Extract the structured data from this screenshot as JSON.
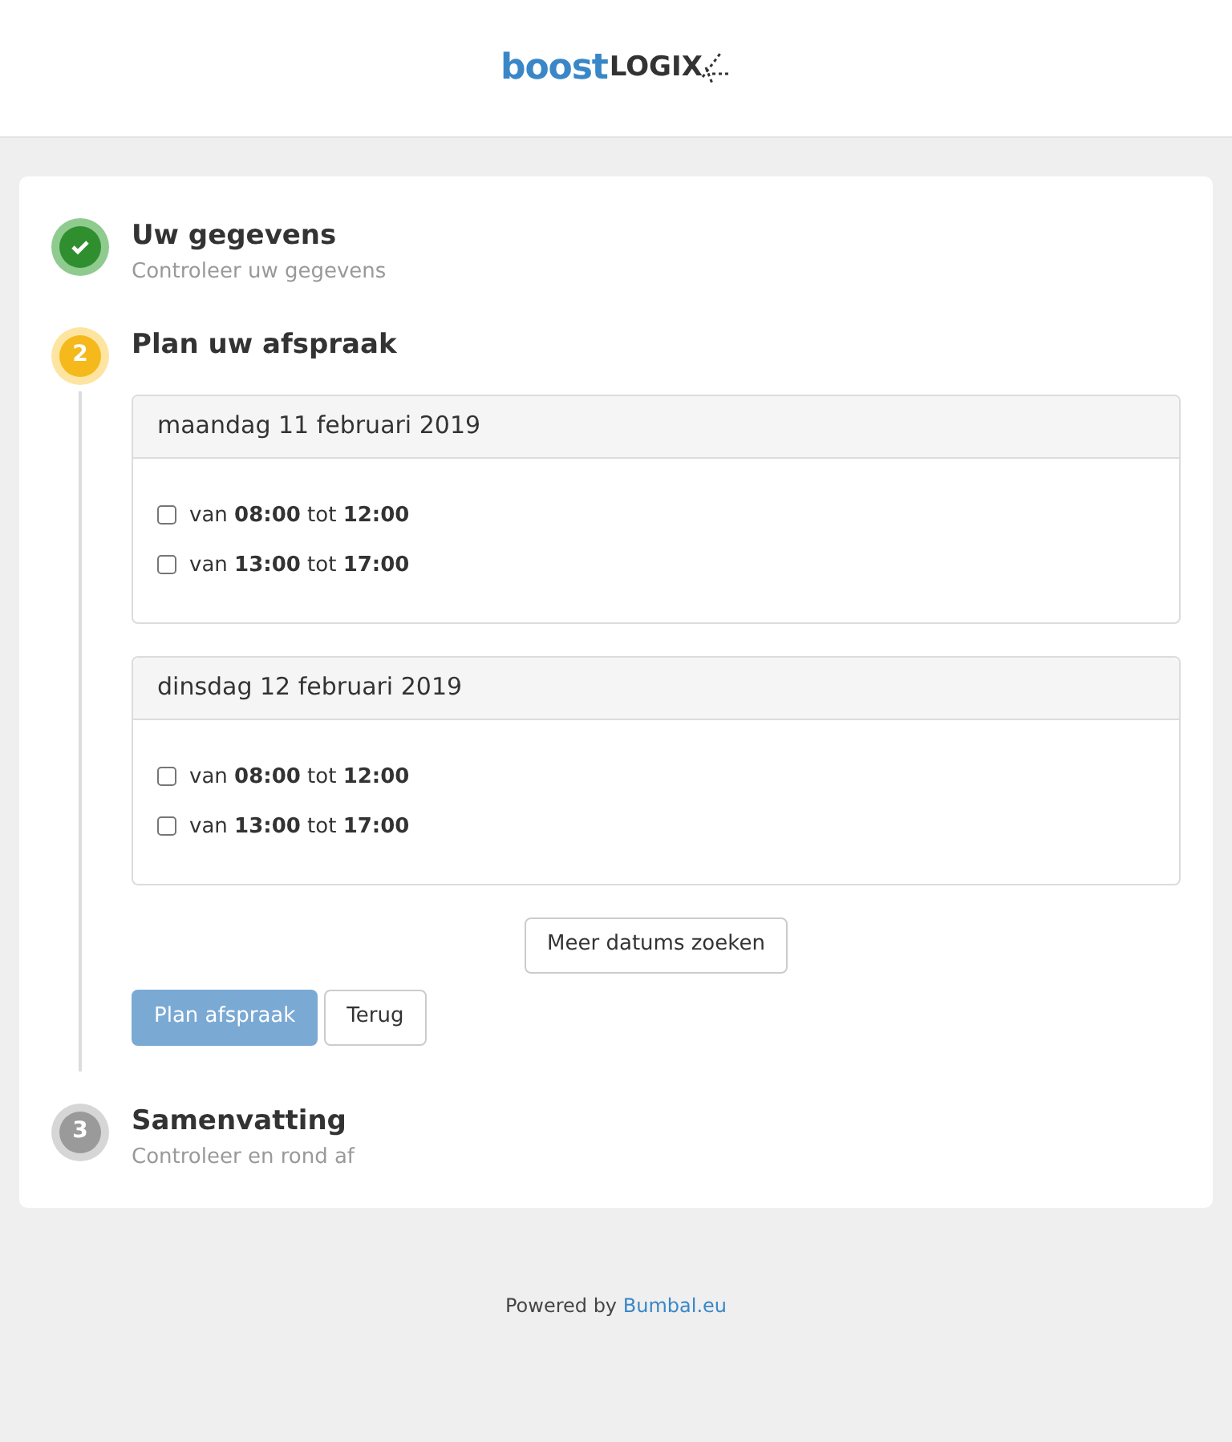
{
  "logo": {
    "part_1": "boost",
    "part_2": "LOGIX"
  },
  "steps": [
    {
      "title": "Uw gegevens",
      "subtitle": "Controleer uw gegevens",
      "kind": "done"
    },
    {
      "number": "2",
      "title": "Plan uw afspraak",
      "kind": "active",
      "days": [
        {
          "date": "maandag 11 februari 2019",
          "slots": [
            {
              "label": "van **08:00** tot **12:00**",
              "checked": false
            },
            {
              "label": "van **13:00** tot **17:00**",
              "checked": false
            }
          ]
        },
        {
          "date": "dinsdag 12 februari 2019",
          "slots": [
            {
              "label": "van **08:00** tot **12:00**",
              "checked": false
            },
            {
              "label": "van **13:00** tot **17:00**",
              "checked": false
            }
          ]
        }
      ],
      "more_button": "Meer datums zoeken",
      "buttons": [
        {
          "label": "Plan afspraak",
          "kind": "primary",
          "disabled": true
        },
        {
          "label": "Terug",
          "kind": "secondary",
          "disabled": false
        }
      ]
    },
    {
      "number": "3",
      "title": "Samenvatting",
      "subtitle": "Controleer en rond af",
      "kind": "pending"
    }
  ],
  "footer": {
    "text": "Powered by",
    "link": "Bumbal.eu"
  }
}
